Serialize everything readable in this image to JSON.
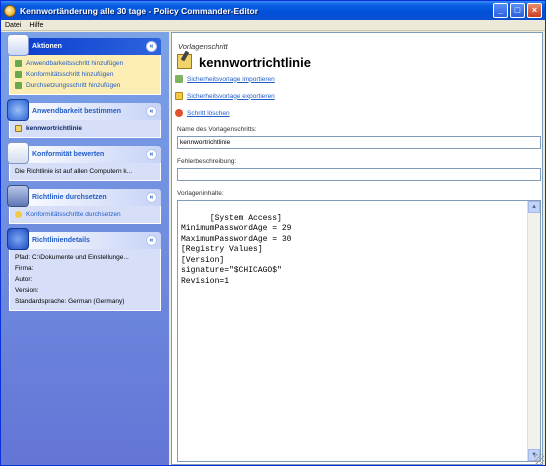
{
  "window": {
    "title": "Kennwortänderung alle 30 tage - Policy Commander-Editor"
  },
  "menu": [
    {
      "label": "Datei"
    },
    {
      "label": "Hilfe"
    }
  ],
  "sidebar": {
    "aktionen": {
      "title": "Aktionen",
      "items": [
        {
          "label": "Anwendbarkeitsschritt hinzufügen"
        },
        {
          "label": "Konformitätsschritt hinzufügen"
        },
        {
          "label": "Durchsetzungsschritt hinzufügen"
        }
      ]
    },
    "anwendbarkeit": {
      "title": "Anwendbarkeit bestimmen",
      "item": "kennwortrichtlinie"
    },
    "konformitaet": {
      "title": "Konformität bewerten",
      "item": "Die Richtlinie ist auf allen Computern k..."
    },
    "durchsetzen": {
      "title": "Richtlinie durchsetzen",
      "item": "Konformitätsschritte durchsetzen"
    },
    "details": {
      "title": "Richtliniendetails",
      "rows": [
        {
          "label": "Pfad: C:\\Dokumente und Einstellunge..."
        },
        {
          "label": "Firma:"
        },
        {
          "label": "Autor:"
        },
        {
          "label": "Version:"
        },
        {
          "label": "Standardsprache: German (Germany)"
        }
      ]
    }
  },
  "main": {
    "supertitle": "Vorlagenschritt",
    "title": "kennwortrichtlinie",
    "actions": [
      {
        "label": "Sicherheitsvorlage importieren"
      },
      {
        "label": "Sicherheitsvorlage exportieren"
      },
      {
        "label": "Schritt löschen"
      }
    ],
    "name_label": "Name des Vorlagenschritts:",
    "name_value": "kennwortrichtlinie",
    "error_label": "Fehlerbeschreibung:",
    "error_value": "",
    "content_label": "Vorlageninhalte:",
    "content_value": "[System Access]\nMinimumPasswordAge = 29\nMaximumPasswordAge = 30\n[Registry Values]\n[Version]\nsignature=\"$CHICAGO$\"\nRevision=1"
  },
  "colors": {
    "title_bar": "#0050d8",
    "sidebar_bg": "#6f8ee0",
    "link": "#215dc6",
    "highlight_panel": "#fbedb4"
  }
}
